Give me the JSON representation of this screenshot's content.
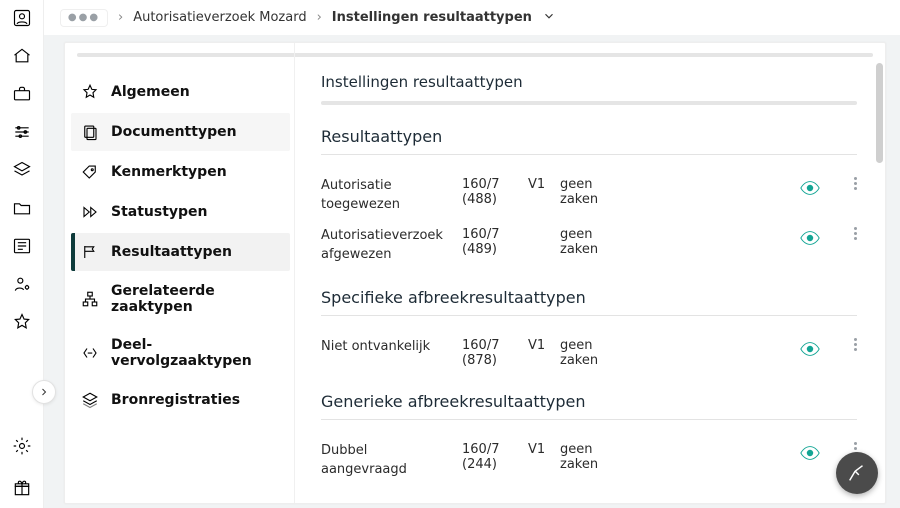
{
  "breadcrumb": {
    "level1": "Autorisatieverzoek Mozard",
    "current": "Instellingen resultaattypen"
  },
  "sidebar": {
    "items": [
      {
        "label": "Algemeen",
        "selected": false
      },
      {
        "label": "Documenttypen",
        "selected": false
      },
      {
        "label": "Kenmerktypen",
        "selected": false
      },
      {
        "label": "Statustypen",
        "selected": false
      },
      {
        "label": "Resultaattypen",
        "selected": true
      },
      {
        "label": "Gerelateerde zaaktypen",
        "selected": false
      },
      {
        "label": "Deel-vervolgzaaktypen",
        "selected": false
      },
      {
        "label": "Bronregistraties",
        "selected": false
      }
    ]
  },
  "content": {
    "page_title": "Instellingen resultaattypen",
    "sections": [
      {
        "heading": "Resultaattypen",
        "rows": [
          {
            "name": "Autorisatie toegewezen",
            "code": "160/7 (488)",
            "version": "V1",
            "status": "geen zaken"
          },
          {
            "name": "Autorisatieverzoek afgewezen",
            "code": "160/7 (489)",
            "version": "",
            "status": "geen zaken"
          }
        ]
      },
      {
        "heading": "Specifieke afbreekresultaattypen",
        "rows": [
          {
            "name": "Niet ontvankelijk",
            "code": "160/7 (878)",
            "version": "V1",
            "status": "geen zaken"
          }
        ]
      },
      {
        "heading": "Generieke afbreekresultaattypen",
        "rows": [
          {
            "name": "Dubbel aangevraagd",
            "code": "160/7 (244)",
            "version": "V1",
            "status": "geen zaken"
          }
        ]
      }
    ]
  }
}
